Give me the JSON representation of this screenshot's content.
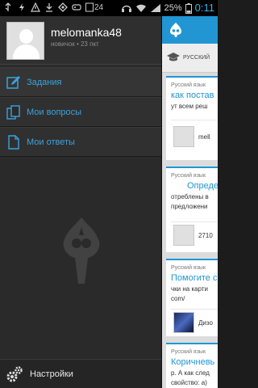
{
  "status_bar": {
    "battery_percent": "25%",
    "time": "0:11",
    "time_color": "#3ab0e8",
    "left_icons": [
      "usb-icon",
      "charging-icon",
      "warning-icon",
      "download-icon",
      "app-icon",
      "gamepad-icon",
      "notification-count-icon"
    ],
    "notification_count": "24",
    "right_icons": [
      "headset-icon",
      "wifi-icon",
      "signal-icon",
      "battery-icon"
    ]
  },
  "profile": {
    "username": "melomanka48",
    "rank": "новичок",
    "separator": "•",
    "points": "23 пкт"
  },
  "menu": {
    "items": [
      {
        "label": "Задания",
        "icon": "tasks-icon"
      },
      {
        "label": "Мои вопросы",
        "icon": "my-questions-icon"
      },
      {
        "label": "Мои ответы",
        "icon": "my-answers-icon"
      }
    ]
  },
  "settings": {
    "label": "Настройки",
    "icon": "gear-icon"
  },
  "content": {
    "subject_filter": "РУССКИЙ",
    "cards": [
      {
        "subject": "Русский язык",
        "title": "как постав",
        "text": "ут всем реш",
        "user": "mell"
      },
      {
        "subject": "Русский язык",
        "title": "Опреде",
        "text": "отреблены в",
        "text2": "предложени",
        "user": "2710"
      },
      {
        "subject": "Русский язык",
        "title": "Помогите с",
        "text": "чки на карти",
        "text2": "com/",
        "user": "Дизо"
      },
      {
        "subject": "Русский язык",
        "title": "Коричневь",
        "text": "р. А как след",
        "text2": "свойство: а)"
      }
    ]
  },
  "colors": {
    "accent": "#2196d3",
    "menu_label": "#3aa3dd",
    "drawer_bg": "#2a2a2a"
  }
}
